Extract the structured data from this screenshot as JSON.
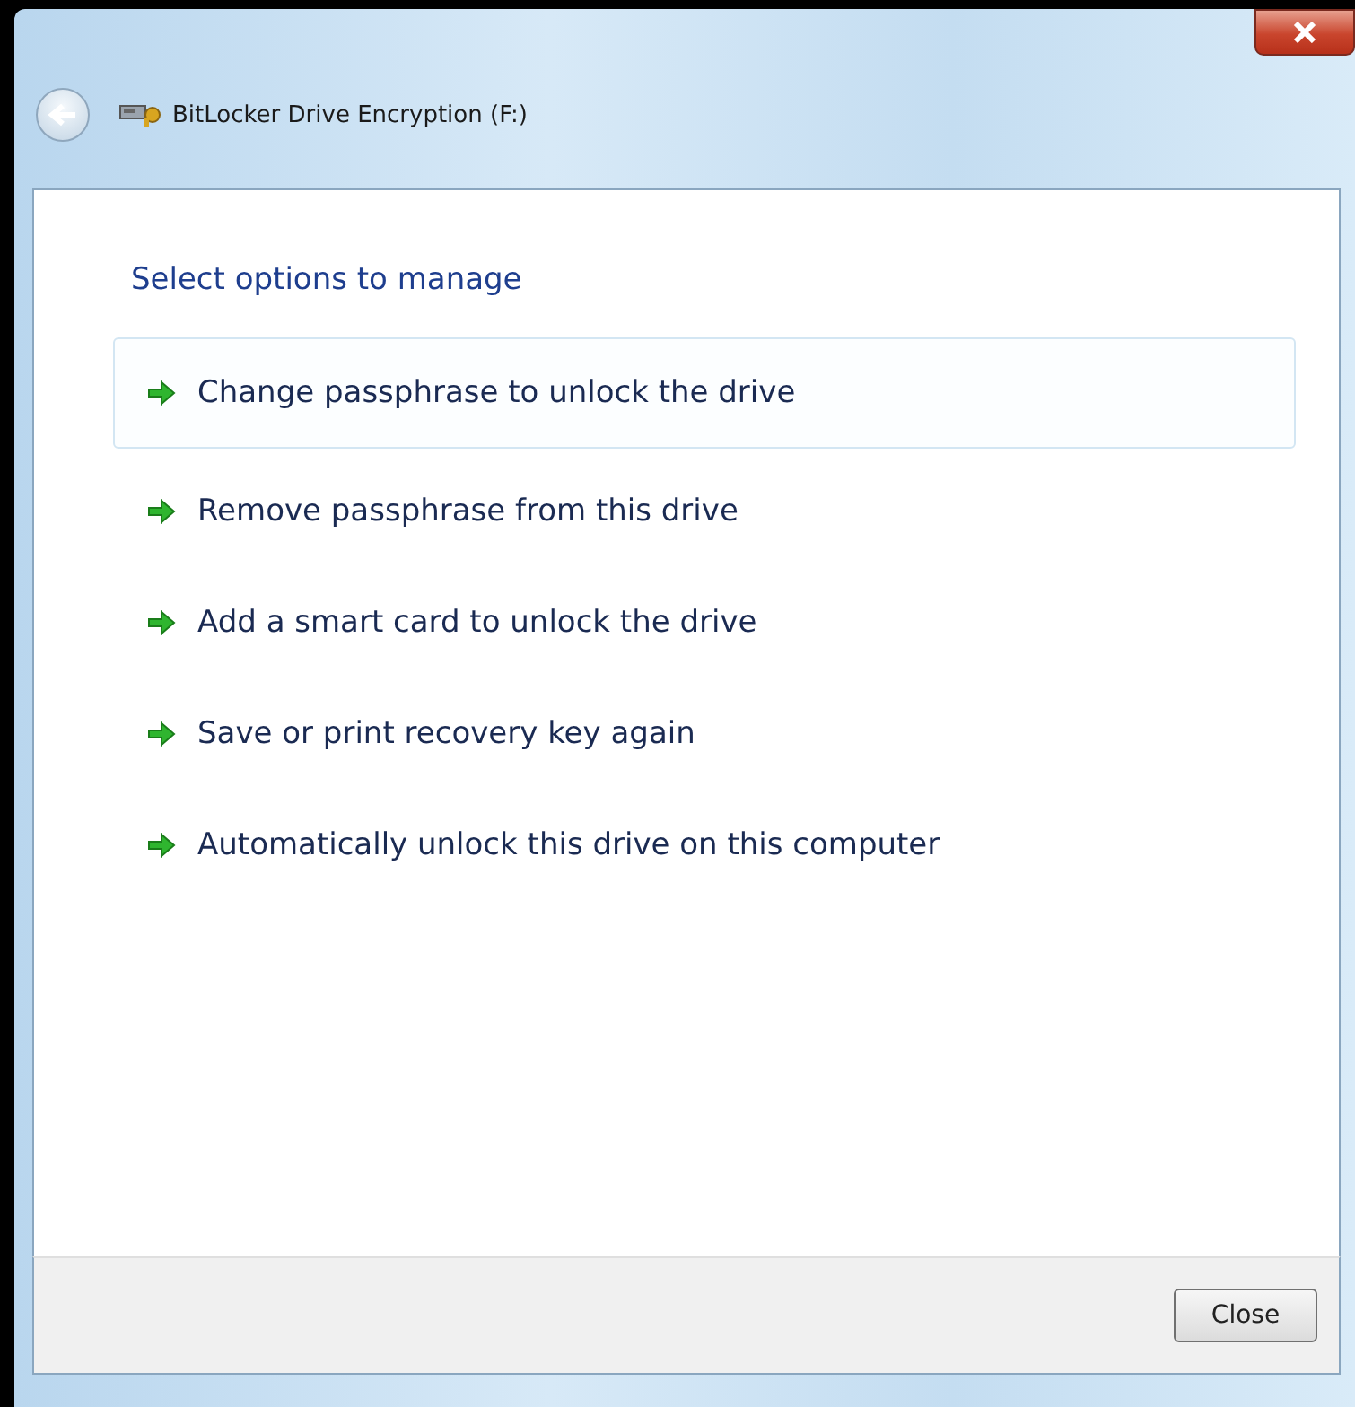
{
  "window": {
    "title": "BitLocker Drive Encryption (F:)"
  },
  "heading": "Select options to manage",
  "options": [
    {
      "label": "Change passphrase to unlock the drive",
      "highlighted": true
    },
    {
      "label": "Remove passphrase from this drive",
      "highlighted": false
    },
    {
      "label": "Add a smart card to unlock the drive",
      "highlighted": false
    },
    {
      "label": "Save or print recovery key again",
      "highlighted": false
    },
    {
      "label": "Automatically unlock this drive on this computer",
      "highlighted": false
    }
  ],
  "buttons": [
    "Close"
  ]
}
